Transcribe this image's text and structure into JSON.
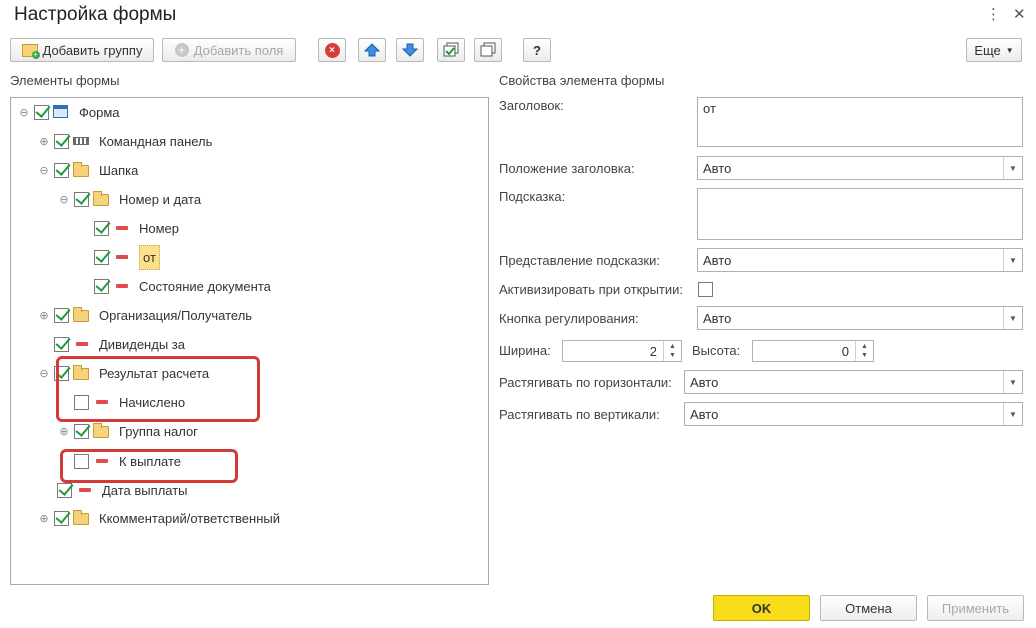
{
  "window": {
    "title": "Настройка формы",
    "more_icon": "⋮",
    "close_icon": "✕"
  },
  "toolbar": {
    "add_group": "Добавить группу",
    "add_fields": "Добавить поля",
    "help": "?",
    "more": "Еще"
  },
  "left": {
    "label": "Элементы формы"
  },
  "tree": [
    {
      "label": "Форма"
    },
    {
      "label": "Командная панель"
    },
    {
      "label": "Шапка"
    },
    {
      "label": "Номер и дата"
    },
    {
      "label": "Номер"
    },
    {
      "label": "от"
    },
    {
      "label": "Состояние документа"
    },
    {
      "label": "Организация/Получатель"
    },
    {
      "label": "Дивиденды за"
    },
    {
      "label": "Результат расчета"
    },
    {
      "label": "Начислено"
    },
    {
      "label": "Группа налог"
    },
    {
      "label": "К выплате"
    },
    {
      "label": "Дата выплаты"
    },
    {
      "label": "Ккомментарий/ответственный"
    }
  ],
  "right": {
    "label": "Свойства элемента формы",
    "title_label": "Заголовок:",
    "title_value": "от",
    "title_position_label": "Положение заголовка:",
    "title_position_value": "Авто",
    "tooltip_label": "Подсказка:",
    "tooltip_value": "",
    "tooltip_repr_label": "Представление подсказки:",
    "tooltip_repr_value": "Авто",
    "activate_label": "Активизировать при открытии:",
    "adjust_button_label": "Кнопка регулирования:",
    "adjust_button_value": "Авто",
    "width_label": "Ширина:",
    "width_value": "2",
    "height_label": "Высота:",
    "height_value": "0",
    "stretch_h_label": "Растягивать по горизонтали:",
    "stretch_h_value": "Авто",
    "stretch_v_label": "Растягивать по вертикали:",
    "stretch_v_value": "Авто"
  },
  "footer": {
    "ok": "OK",
    "cancel": "Отмена",
    "apply": "Применить"
  },
  "colors": {
    "ok_button": "#f7dc1a",
    "highlight_box": "#d43a37",
    "check": "#1d9a3b",
    "selected_label": "#fbe18b"
  }
}
